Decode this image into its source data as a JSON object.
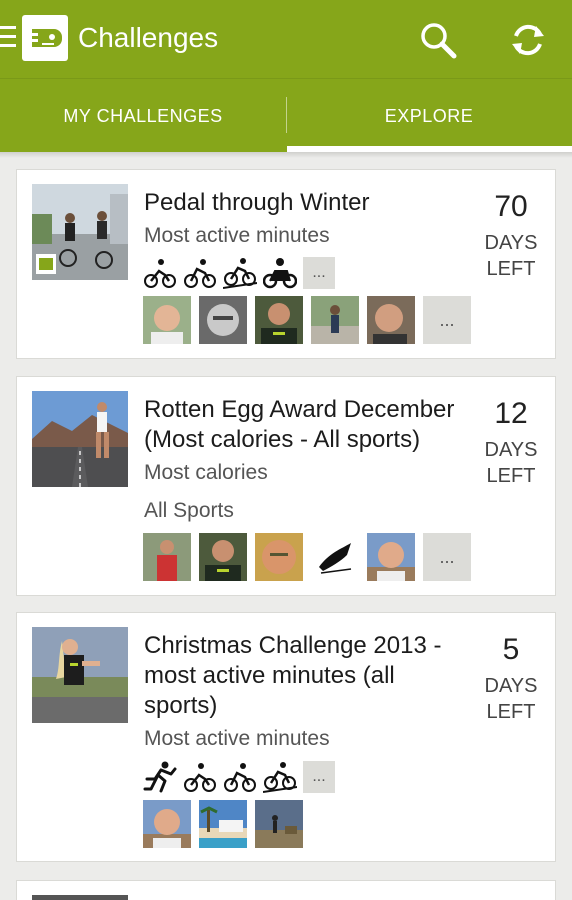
{
  "appbar": {
    "title": "Challenges"
  },
  "tabs": [
    {
      "label": "MY CHALLENGES"
    },
    {
      "label": "EXPLORE"
    }
  ],
  "colors": {
    "accent": "#86a61a"
  },
  "challenges": [
    {
      "title": "Pedal through Winter",
      "metric": "Most active minutes",
      "sports": "",
      "days_num": "70",
      "days_label1": "DAYS",
      "days_label2": "LEFT",
      "sport_icons": [
        "cycling-icon",
        "cycling-icon",
        "mountain-biking-icon",
        "motorcycling-icon"
      ],
      "more": "..."
    },
    {
      "title": "Rotten Egg Award December (Most calories - All sports)",
      "metric": "Most calories",
      "sports": "All Sports",
      "days_num": "12",
      "days_label1": "DAYS",
      "days_label2": "LEFT",
      "more": "..."
    },
    {
      "title": "Christmas Challenge 2013 - most active minutes (all sports)",
      "metric": "Most active minutes",
      "sports": "",
      "days_num": "5",
      "days_label1": "DAYS",
      "days_label2": "LEFT",
      "sport_icons": [
        "running-icon",
        "cycling-icon",
        "cycling-icon",
        "mountain-biking-icon"
      ],
      "more": "..."
    }
  ]
}
